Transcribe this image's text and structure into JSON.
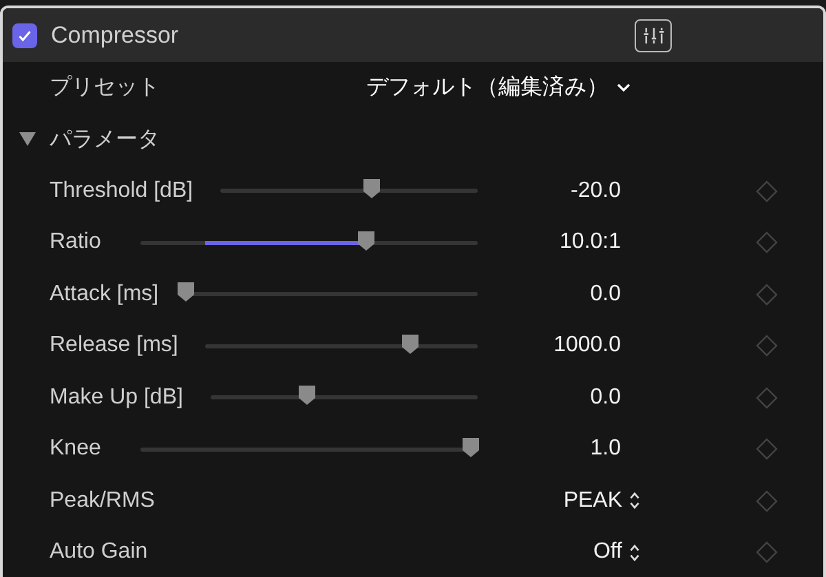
{
  "effect": {
    "name": "Compressor",
    "enabled": true
  },
  "preset": {
    "label": "プリセット",
    "value": "デフォルト（編集済み）"
  },
  "section": {
    "title": "パラメータ",
    "expanded": true
  },
  "parameters": [
    {
      "kind": "slider",
      "label": "Threshold [dB]",
      "level": 0.59,
      "value": "-20.0",
      "highlighted": false
    },
    {
      "kind": "slider",
      "label": "Ratio",
      "level": 0.67,
      "value": "10.0:1",
      "highlighted": true
    },
    {
      "kind": "slider",
      "label": "Attack [ms]",
      "level": 0,
      "value": "0.0",
      "highlighted": false
    },
    {
      "kind": "slider",
      "label": "Release [ms]",
      "level": 0.75,
      "value": "1000.0",
      "highlighted": false
    },
    {
      "kind": "slider",
      "label": "Make Up [dB]",
      "level": 0.36,
      "value": "0.0",
      "highlighted": false
    },
    {
      "kind": "slider",
      "label": "Knee",
      "level": 0.98,
      "value": "1.0",
      "highlighted": false
    },
    {
      "kind": "popup",
      "label": "Peak/RMS",
      "value": "PEAK"
    },
    {
      "kind": "popup",
      "label": "Auto Gain",
      "value": "Off"
    }
  ]
}
